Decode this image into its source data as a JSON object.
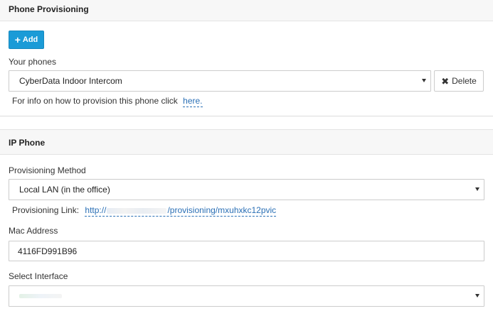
{
  "phone_provisioning": {
    "title": "Phone Provisioning",
    "add_label": "Add",
    "your_phones_label": "Your phones",
    "selected_phone": "CyberData Indoor Intercom",
    "delete_label": "Delete",
    "info_text": "For info on how to provision this phone click",
    "info_link": "here."
  },
  "ip_phone": {
    "title": "IP Phone",
    "provisioning_method_label": "Provisioning Method",
    "provisioning_method_value": "Local LAN (in the office)",
    "provisioning_link_label": "Provisioning Link:",
    "provisioning_link_prefix": "http://",
    "provisioning_link_suffix": "/provisioning/mxuhxkc12pvic",
    "mac_address_label": "Mac Address",
    "mac_address_value": "4116FD991B96",
    "select_interface_label": "Select Interface"
  },
  "icons": {
    "add": "plus-icon",
    "delete": "x-icon",
    "dropdown": "caret-down-icon"
  },
  "colors": {
    "primary_button": "#1b9bd7",
    "link": "#2a6fb5",
    "section_header_bg": "#f7f7f7"
  }
}
